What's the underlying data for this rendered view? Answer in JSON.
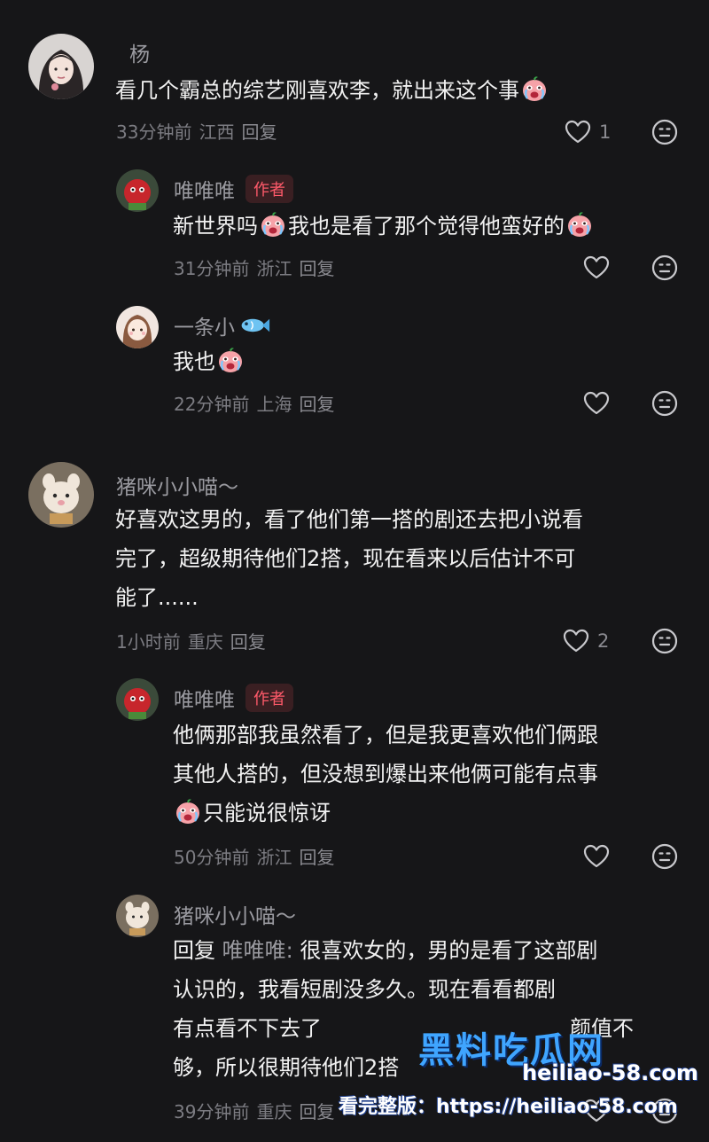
{
  "comments": [
    {
      "username": "杨",
      "text_lines": [
        "看几个霸总的综艺刚喜欢李，就出来这个事"
      ],
      "time": "33分钟前",
      "location": "江西",
      "reply_label": "回复",
      "likes": "1",
      "replies": [
        {
          "username": "唯唯唯",
          "badge": "作者",
          "text_parts": [
            "新世界吗",
            "我也是看了那个觉得他蛮好的"
          ],
          "time": "31分钟前",
          "location": "浙江",
          "reply_label": "回复"
        },
        {
          "username": "一条小",
          "text_parts": [
            "我也"
          ],
          "time": "22分钟前",
          "location": "上海",
          "reply_label": "回复"
        }
      ]
    },
    {
      "username": "猪咪小小喵～",
      "text_lines": [
        "好喜欢这男的，看了他们第一搭的剧还去把小说看",
        "完了，超级期待他们2搭，现在看来以后估计不可",
        "能了......"
      ],
      "time": "1小时前",
      "location": "重庆",
      "reply_label": "回复",
      "likes": "2",
      "replies": [
        {
          "username": "唯唯唯",
          "badge": "作者",
          "text_lines": [
            "他俩那部我虽然看了，但是我更喜欢他们俩跟",
            "其他人搭的，但没想到爆出来他俩可能有点事",
            "只能说很惊讶"
          ],
          "time": "50分钟前",
          "location": "浙江",
          "reply_label": "回复"
        },
        {
          "username": "猪咪小小喵～",
          "reply_prefix": "回复",
          "reply_target": "唯唯唯:",
          "text_lines": [
            "很喜欢女的，男的是看了这部剧",
            "认识的，我看短剧没多久。现在看看都剧",
            "有点看不下去了",
            "够，所以很期待他们2搭"
          ],
          "extra_line_tail": "颜值不",
          "time": "39分钟前",
          "location": "重庆",
          "reply_label": "回复"
        }
      ]
    }
  ],
  "watermark": {
    "title": "黑料吃瓜网",
    "domain": "heiliao-58.com",
    "line": "看完整版：https://heiliao-58.com"
  },
  "colors": {
    "background": "#161618",
    "text": "#f2f2f2",
    "muted": "#7c7c82",
    "badge_bg": "#3a1f22",
    "badge_text": "#ff5a6a",
    "watermark_blue": "#3fa5ff"
  },
  "icons": {
    "like": "heart-outline-icon",
    "dislike": "neutral-face-icon",
    "emoji_cry": "crying-face-emoji",
    "emoji_fish": "fish-emoji"
  }
}
